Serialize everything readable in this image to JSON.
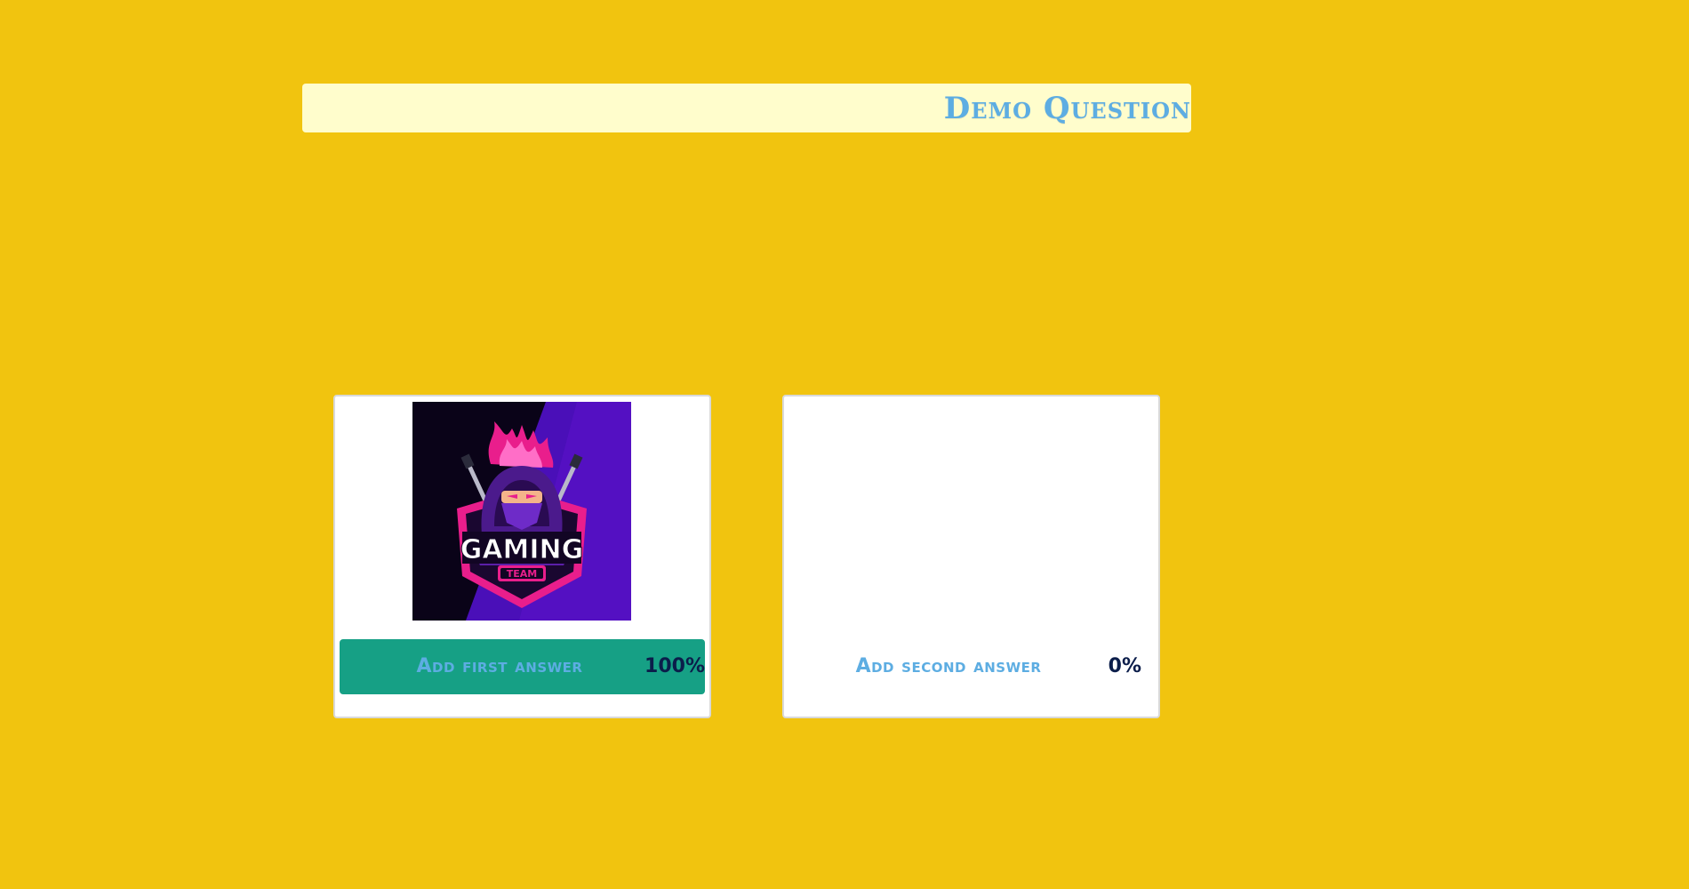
{
  "question": {
    "title": "Demo Question"
  },
  "answers": [
    {
      "label": "Add first answer",
      "percent": "100%",
      "percent_value": 100,
      "selected": true,
      "has_image": true,
      "image": {
        "icon": "gaming-team-logo",
        "text_main": "GAMING",
        "text_sub": "TEAM"
      }
    },
    {
      "label": "Add second answer",
      "percent": "0%",
      "percent_value": 0,
      "selected": false,
      "has_image": false
    }
  ],
  "colors": {
    "background": "#F1C40F",
    "question_bar": "#FFFDCC",
    "question_text": "#5DADE2",
    "answer_selected": "#16A085",
    "answer_text": "#5DADE2",
    "percent_text": "#0B1D4A",
    "logo_magenta": "#E91E8C",
    "logo_purple": "#5B10C8",
    "logo_dark": "#120524"
  }
}
